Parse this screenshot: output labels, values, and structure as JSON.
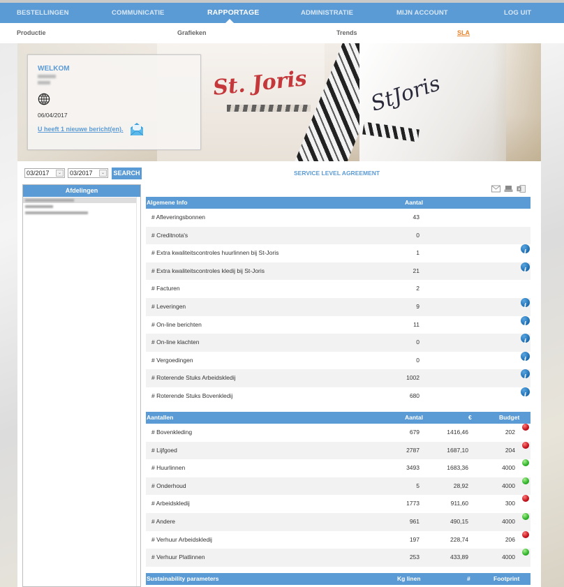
{
  "nav": {
    "main": [
      {
        "label": "BESTELLINGEN",
        "active": false
      },
      {
        "label": "COMMUNICATIE",
        "active": false
      },
      {
        "label": "RAPPORTAGE",
        "active": true
      },
      {
        "label": "ADMINISTRATIE",
        "active": false
      },
      {
        "label": "MIJN ACCOUNT",
        "active": false
      },
      {
        "label": "LOG UIT",
        "active": false
      }
    ],
    "sub": [
      {
        "label": "Productie",
        "active": false
      },
      {
        "label": "Grafieken",
        "active": false
      },
      {
        "label": "Trends",
        "active": false
      },
      {
        "label": "SLA",
        "active": true
      }
    ]
  },
  "banner": {
    "logo_text_1": "St. Joris",
    "logo_text_2": "StJoris"
  },
  "welcome": {
    "title": "WELKOM",
    "date": "06/04/2017",
    "message_link": "U heeft 1 nieuwe bericht(en).",
    "globe_icon": "globe-icon",
    "mail_icon": "open-envelope-icon"
  },
  "filters": {
    "from_period": "03/2017",
    "to_period": "03/2017",
    "search_label": "SEARCH"
  },
  "departments": {
    "header": "Afdelingen"
  },
  "sla": {
    "title": "SERVICE LEVEL AGREEMENT",
    "export_icons": [
      "mail-icon",
      "print-icon",
      "excel-icon"
    ],
    "general": {
      "headers": {
        "label": "Algemene Info",
        "count": "Aantal"
      },
      "rows": [
        {
          "label": "# Afleveringsbonnen",
          "count": "43",
          "info": false
        },
        {
          "label": "# Creditnota's",
          "count": "0",
          "info": false
        },
        {
          "label": "# Extra kwaliteitscontroles huurlinnen bij St-Joris",
          "count": "1",
          "info": true
        },
        {
          "label": "# Extra kwaliteitscontroles kledij bij St-Joris",
          "count": "21",
          "info": true
        },
        {
          "label": "# Facturen",
          "count": "2",
          "info": false
        },
        {
          "label": "# Leveringen",
          "count": "9",
          "info": true
        },
        {
          "label": "# On-line berichten",
          "count": "11",
          "info": true
        },
        {
          "label": "# On-line klachten",
          "count": "0",
          "info": true
        },
        {
          "label": "# Vergoedingen",
          "count": "0",
          "info": true
        },
        {
          "label": "# Roterende Stuks Arbeidskledij",
          "count": "1002",
          "info": true
        },
        {
          "label": "# Roterende Stuks Bovenkledij",
          "count": "680",
          "info": true
        }
      ]
    },
    "counts": {
      "headers": {
        "label": "Aantallen",
        "count": "Aantal",
        "amount": "€",
        "budget": "Budget"
      },
      "rows": [
        {
          "label": "# Bovenkleding",
          "count": "679",
          "amount": "1416,46",
          "budget": "202",
          "status": "red"
        },
        {
          "label": "# Lijfgoed",
          "count": "2787",
          "amount": "1687,10",
          "budget": "204",
          "status": "red"
        },
        {
          "label": "# Huurlinnen",
          "count": "3493",
          "amount": "1683,36",
          "budget": "4000",
          "status": "green"
        },
        {
          "label": "# Onderhoud",
          "count": "5",
          "amount": "28,92",
          "budget": "4000",
          "status": "green"
        },
        {
          "label": "# Arbeidskledij",
          "count": "1773",
          "amount": "911,60",
          "budget": "300",
          "status": "red"
        },
        {
          "label": "# Andere",
          "count": "961",
          "amount": "490,15",
          "budget": "4000",
          "status": "green"
        },
        {
          "label": "# Verhuur Arbeidskledij",
          "count": "197",
          "amount": "228,74",
          "budget": "206",
          "status": "red"
        },
        {
          "label": "# Verhuur Platlinnen",
          "count": "253",
          "amount": "433,89",
          "budget": "4000",
          "status": "green"
        }
      ]
    },
    "sustainability": {
      "headers": {
        "label": "Sustainability parameters",
        "kg": "Kg linen",
        "count": "#",
        "footprint": "Footprint"
      }
    }
  },
  "colors": {
    "brand_blue": "#5b9bd5",
    "active_subnav": "#e8822a",
    "status_red": "#c1121b",
    "status_green": "#2fb22a"
  }
}
